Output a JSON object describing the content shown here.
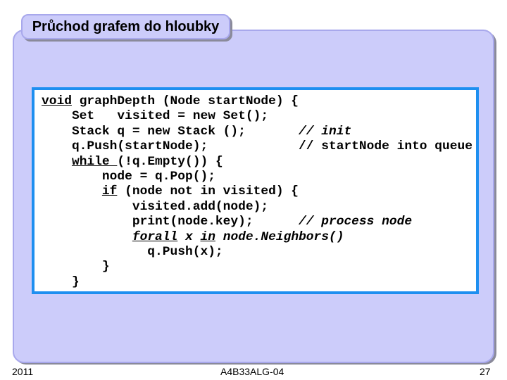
{
  "slide": {
    "title": "Průchod grafem do hloubky",
    "colors": {
      "panel": "#ccccfa",
      "panel_border": "#a8a8ec",
      "code_border": "#1e8ff0"
    }
  },
  "code": {
    "lines": [
      [
        {
          "t": "void",
          "kw": true
        },
        {
          "t": " graphDepth (Node startNode) {"
        }
      ],
      [
        {
          "t": "    Set   visited = new Set();"
        }
      ],
      [
        {
          "t": "    Stack q = new Stack ();       "
        },
        {
          "t": "// init",
          "it": true
        }
      ],
      [
        {
          "t": "    q.Push(startNode);            // startNode into queue"
        }
      ],
      [
        {
          "t": "    "
        },
        {
          "t": "while ",
          "kw": true
        },
        {
          "t": "(!q.Empty()) {"
        }
      ],
      [
        {
          "t": "        node = q.Pop();"
        }
      ],
      [
        {
          "t": "        "
        },
        {
          "t": "if",
          "kw": true
        },
        {
          "t": " (node not in visited) {"
        }
      ],
      [
        {
          "t": "            visited.add(node);"
        }
      ],
      [
        {
          "t": "            print(node.key);      "
        },
        {
          "t": "// process node",
          "it": true
        }
      ],
      [
        {
          "t": "            "
        },
        {
          "t": "forall",
          "kw": true,
          "it": true
        },
        {
          "t": " x ",
          "it": true
        },
        {
          "t": "in",
          "kw": true,
          "it": true
        },
        {
          "t": " node.Neighbors()",
          "it": true
        }
      ],
      [
        {
          "t": "              q.Push(x);"
        }
      ],
      [
        {
          "t": "        }"
        }
      ],
      [
        {
          "t": "    }"
        }
      ]
    ]
  },
  "footer": {
    "year": "2011",
    "course": "A4B33ALG-04",
    "page": "27"
  }
}
